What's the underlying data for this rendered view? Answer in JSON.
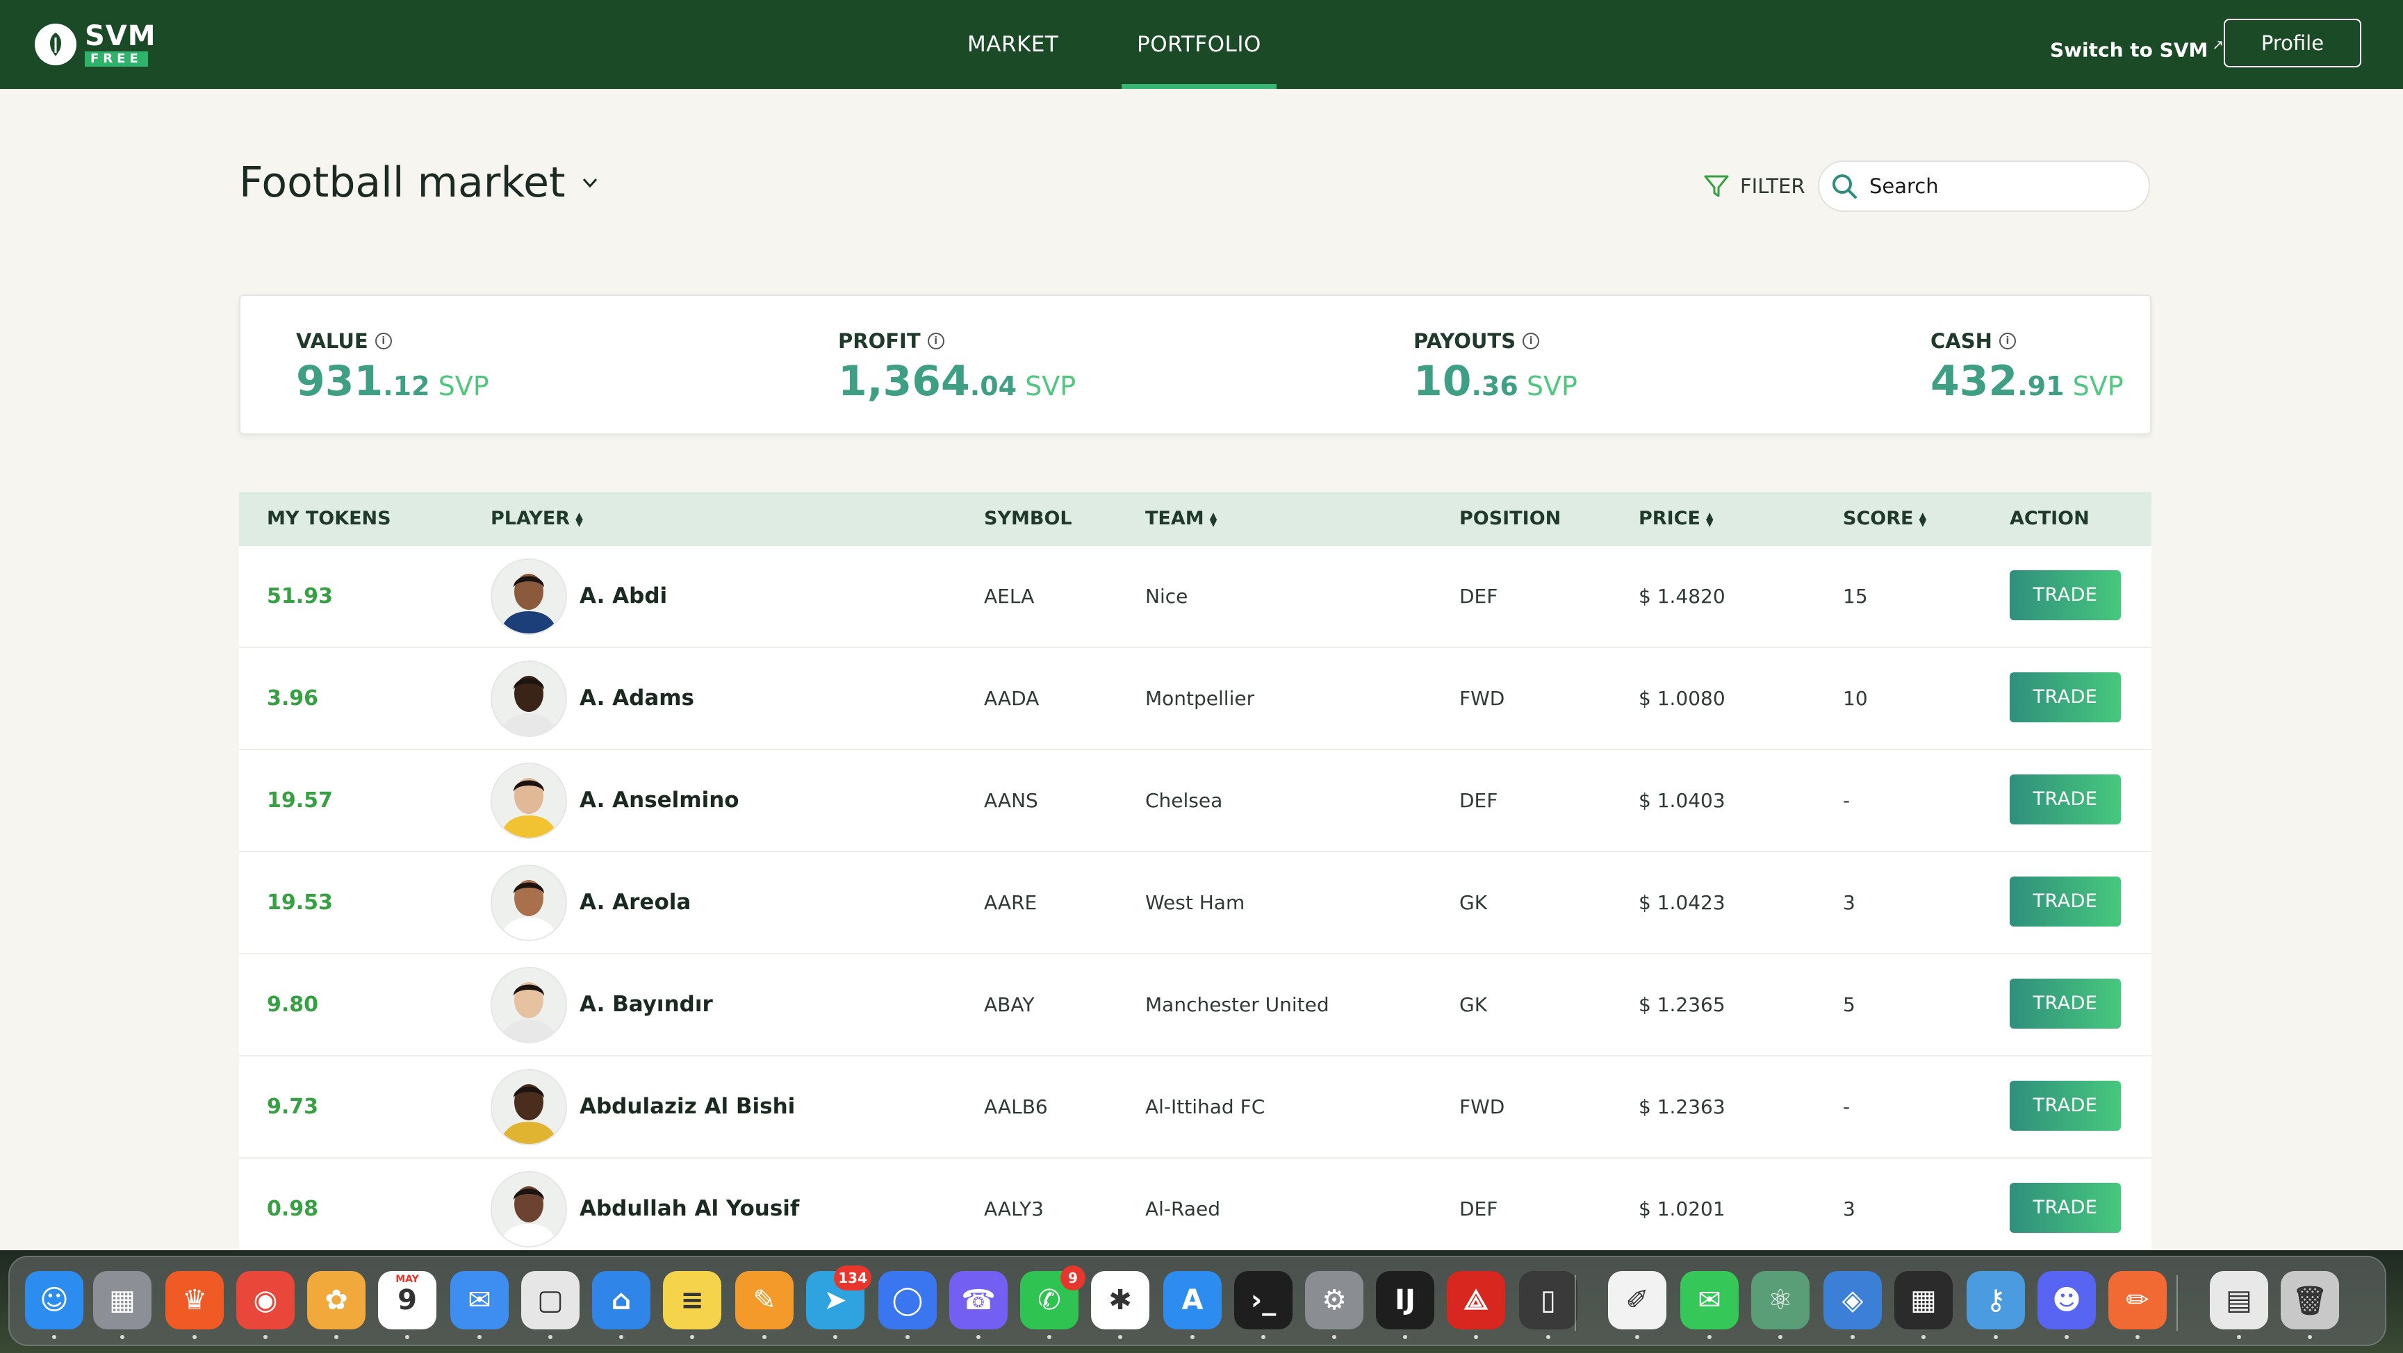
{
  "brand": {
    "name": "SVM",
    "badge": "FREE"
  },
  "nav": {
    "items": [
      {
        "label": "MARKET",
        "active": false
      },
      {
        "label": "PORTFOLIO",
        "active": true
      }
    ],
    "switch_label": "Switch to SVM",
    "profile_label": "Profile"
  },
  "header": {
    "title": "Football market",
    "filter_label": "FILTER",
    "search_placeholder": "Search"
  },
  "stats": [
    {
      "label": "VALUE",
      "int": "931",
      "dec": ".12",
      "unit": "SVP"
    },
    {
      "label": "PROFIT",
      "int": "1,364",
      "dec": ".04",
      "unit": "SVP"
    },
    {
      "label": "PAYOUTS",
      "int": "10",
      "dec": ".36",
      "unit": "SVP"
    },
    {
      "label": "CASH",
      "int": "432",
      "dec": ".91",
      "unit": "SVP"
    }
  ],
  "table": {
    "columns": {
      "tokens": "MY TOKENS",
      "player": "PLAYER",
      "symbol": "SYMBOL",
      "team": "TEAM",
      "position": "POSITION",
      "price": "PRICE",
      "score": "SCORE",
      "action": "ACTION"
    },
    "trade_label": "TRADE",
    "rows": [
      {
        "tokens": "51.93",
        "player": "A. Abdi",
        "symbol": "AELA",
        "team": "Nice",
        "position": "DEF",
        "price": "$ 1.4820",
        "score": "15"
      },
      {
        "tokens": "3.96",
        "player": "A. Adams",
        "symbol": "AADA",
        "team": "Montpellier",
        "position": "FWD",
        "price": "$ 1.0080",
        "score": "10"
      },
      {
        "tokens": "19.57",
        "player": "A. Anselmino",
        "symbol": "AANS",
        "team": "Chelsea",
        "position": "DEF",
        "price": "$ 1.0403",
        "score": "-"
      },
      {
        "tokens": "19.53",
        "player": "A. Areola",
        "symbol": "AARE",
        "team": "West Ham",
        "position": "GK",
        "price": "$ 1.0423",
        "score": "3"
      },
      {
        "tokens": "9.80",
        "player": "A. Bayındır",
        "symbol": "ABAY",
        "team": "Manchester United",
        "position": "GK",
        "price": "$ 1.2365",
        "score": "5"
      },
      {
        "tokens": "9.73",
        "player": "Abdulaziz Al Bishi",
        "symbol": "AALB6",
        "team": "Al-Ittihad FC",
        "position": "FWD",
        "price": "$ 1.2363",
        "score": "-"
      },
      {
        "tokens": "0.98",
        "player": "Abdullah Al Yousif",
        "symbol": "AALY3",
        "team": "Al-Raed",
        "position": "DEF",
        "price": "$ 1.0201",
        "score": "3"
      }
    ]
  },
  "dock": {
    "apps": [
      {
        "name": "finder-icon",
        "glyph": "☺",
        "color": "#2d8cf0",
        "badge": ""
      },
      {
        "name": "launchpad-icon",
        "glyph": "▦",
        "color": "#8c8f96",
        "badge": ""
      },
      {
        "name": "brave-icon",
        "glyph": "♛",
        "color": "#f05a24",
        "badge": ""
      },
      {
        "name": "chrome-icon",
        "glyph": "◉",
        "color": "#e9473a",
        "badge": ""
      },
      {
        "name": "photos-icon",
        "glyph": "✿",
        "color": "#f2a93b",
        "badge": ""
      },
      {
        "name": "calendar-icon",
        "glyph": "9",
        "color": "#ffffff",
        "badge": "",
        "label": "MAY"
      },
      {
        "name": "mail-icon",
        "glyph": "✉",
        "color": "#3d8ef0",
        "badge": ""
      },
      {
        "name": "preview-icon",
        "glyph": "▢",
        "color": "#e6e6e6",
        "badge": ""
      },
      {
        "name": "keynote-icon",
        "glyph": "⌂",
        "color": "#2f86e8",
        "badge": ""
      },
      {
        "name": "notes-icon",
        "glyph": "≡",
        "color": "#f5d34a",
        "badge": ""
      },
      {
        "name": "pages-icon",
        "glyph": "✎",
        "color": "#f39a2b",
        "badge": ""
      },
      {
        "name": "telegram-icon",
        "glyph": "➤",
        "color": "#2fa3e0",
        "badge": "134"
      },
      {
        "name": "signal-icon",
        "glyph": "◯",
        "color": "#3a76f0",
        "badge": ""
      },
      {
        "name": "viber-icon",
        "glyph": "☎",
        "color": "#7360f2",
        "badge": ""
      },
      {
        "name": "whatsapp-icon",
        "glyph": "✆",
        "color": "#2fc352",
        "badge": "9"
      },
      {
        "name": "slack-icon",
        "glyph": "✱",
        "color": "#ffffff",
        "badge": ""
      },
      {
        "name": "app-store-icon",
        "glyph": "A",
        "color": "#2d8cf0",
        "badge": ""
      },
      {
        "name": "terminal-icon",
        "glyph": "›_",
        "color": "#1e1e1e",
        "badge": ""
      },
      {
        "name": "system-settings-icon",
        "glyph": "⚙",
        "color": "#8a8d92",
        "badge": ""
      },
      {
        "name": "intellij-icon",
        "glyph": "IJ",
        "color": "#1e1e1e",
        "badge": ""
      },
      {
        "name": "acrobat-icon",
        "glyph": "⟁",
        "color": "#d7271e",
        "badge": ""
      },
      {
        "name": "iphone-mirroring-icon",
        "glyph": "▯",
        "color": "#3a3a3a",
        "badge": ""
      },
      {
        "name": "textedit-icon",
        "glyph": "✐",
        "color": "#f2f2f2",
        "badge": ""
      },
      {
        "name": "messages-icon",
        "glyph": "✉",
        "color": "#36c759",
        "badge": ""
      },
      {
        "name": "atom-icon",
        "glyph": "⚛",
        "color": "#5a9e78",
        "badge": ""
      },
      {
        "name": "screenshot-icon",
        "glyph": "◈",
        "color": "#3b7fd6",
        "badge": ""
      },
      {
        "name": "calculator-icon",
        "glyph": "▦",
        "color": "#2b2b2b",
        "badge": ""
      },
      {
        "name": "keychain-icon",
        "glyph": "⚷",
        "color": "#4b9be0",
        "badge": ""
      },
      {
        "name": "discord-icon",
        "glyph": "☻",
        "color": "#5865f2",
        "badge": ""
      },
      {
        "name": "pencil-app-icon",
        "glyph": "✏",
        "color": "#f26a33",
        "badge": ""
      },
      {
        "name": "downloads-stack-icon",
        "glyph": "▤",
        "color": "#e8e8e8",
        "badge": ""
      },
      {
        "name": "trash-icon",
        "glyph": "🗑",
        "color": "#c8c8c8",
        "badge": ""
      }
    ]
  },
  "colors": {
    "nav_bg": "#1a4a26",
    "accent": "#37b872",
    "value_text": "#3e9f84",
    "token_text": "#37a042"
  }
}
